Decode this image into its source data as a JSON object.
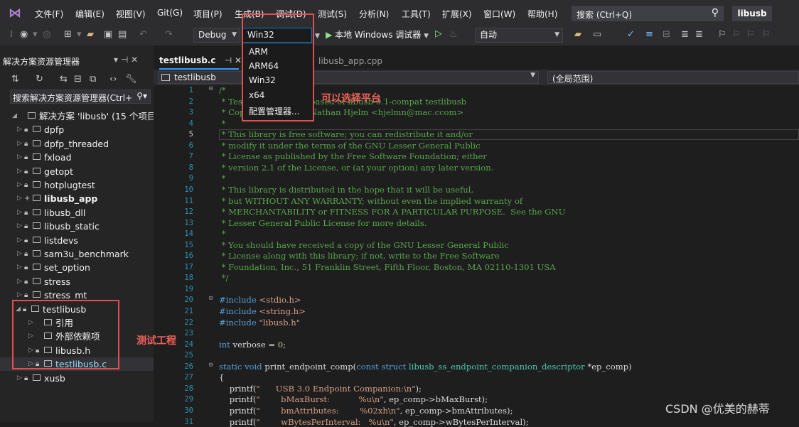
{
  "menu": {
    "items": [
      "文件(F)",
      "编辑(E)",
      "视图(V)",
      "Git(G)",
      "项目(P)",
      "生成(B)",
      "调试(D)",
      "测试(S)",
      "分析(N)",
      "工具(T)",
      "扩展(X)",
      "窗口(W)",
      "帮助(H)"
    ],
    "search_text": "搜索 (Ctrl+Q)",
    "project_badge": "libusb"
  },
  "toolbar": {
    "config": "Debug",
    "platform": "Win32",
    "run_label": "本地 Windows 调试器",
    "run_glyph": "▶",
    "auto": "自动"
  },
  "platform_dropdown": {
    "items": [
      "ARM",
      "ARM64",
      "Win32",
      "x64",
      "配置管理器..."
    ]
  },
  "solution_explorer": {
    "title": "解决方案资源管理器",
    "title_icons": "▾ ⊣ ✕",
    "search_placeholder": "搜索解决方案资源管理器(Ctrl+",
    "solution_label": "解决方案 'libusb' (15 个项目, 共",
    "projects": [
      "dpfp",
      "dpfp_threaded",
      "fxload",
      "getopt",
      "hotplugtest",
      "libusb_app",
      "libusb_dll",
      "libusb_static",
      "listdevs",
      "sam3u_benchmark",
      "set_option",
      "stress",
      "stress_mt",
      "testlibusb"
    ],
    "bold_project": "libusb_app",
    "children": [
      "引用",
      "外部依赖项",
      "libusb.h",
      "testlibusb.c"
    ],
    "last_project": "xusb"
  },
  "editor": {
    "tab_active": "testlibusb.c",
    "tab_active_icons": "⊣ ✕",
    "tab_inactive": "libusb_app.cpp",
    "nav_left": "testlibusb",
    "nav_right": "(全局范围)"
  },
  "code_lines": [
    {
      "n": "1",
      "t": "/*"
    },
    {
      "n": "2",
      "t": " * Test suite program based of libusb-0.1-compat testlibusb"
    },
    {
      "n": "3",
      "t": " * Copyright (c) 2013 Nathan Hjelm <hjelmn@mac.ccom>"
    },
    {
      "n": "4",
      "t": " *"
    },
    {
      "n": "5",
      "t": " * This library is free software; you can redistribute it and/or"
    },
    {
      "n": "6",
      "t": " * modify it under the terms of the GNU Lesser General Public"
    },
    {
      "n": "7",
      "t": " * License as published by the Free Software Foundation; either"
    },
    {
      "n": "8",
      "t": " * version 2.1 of the License, or (at your option) any later version."
    },
    {
      "n": "9",
      "t": " *"
    },
    {
      "n": "10",
      "t": " * This library is distributed in the hope that it will be useful,"
    },
    {
      "n": "11",
      "t": " * but WITHOUT ANY WARRANTY; without even the implied warranty of"
    },
    {
      "n": "12",
      "t": " * MERCHANTABILITY or FITNESS FOR A PARTICULAR PURPOSE.  See the GNU"
    },
    {
      "n": "13",
      "t": " * Lesser General Public License for more details."
    },
    {
      "n": "14",
      "t": " *"
    },
    {
      "n": "15",
      "t": " * You should have received a copy of the GNU Lesser General Public"
    },
    {
      "n": "16",
      "t": " * License along with this library; if not, write to the Free Software"
    },
    {
      "n": "17",
      "t": " * Foundation, Inc., 51 Franklin Street, Fifth Floor, Boston, MA 02110-1301 USA"
    },
    {
      "n": "18",
      "t": " */"
    },
    {
      "n": "19",
      "t": ""
    },
    {
      "n": "20",
      "t": "#include <stdio.h>"
    },
    {
      "n": "21",
      "t": "#include <string.h>"
    },
    {
      "n": "22",
      "t": "#include \"libusb.h\""
    },
    {
      "n": "23",
      "t": ""
    },
    {
      "n": "24",
      "t": "int verbose = 0;"
    },
    {
      "n": "25",
      "t": ""
    },
    {
      "n": "26",
      "t": "static void print_endpoint_comp(const struct libusb_ss_endpoint_companion_descriptor *ep_comp)"
    },
    {
      "n": "27",
      "t": "{"
    },
    {
      "n": "28",
      "t": "    printf(\"      USB 3.0 Endpoint Companion:\\n\");"
    },
    {
      "n": "29",
      "t": "    printf(\"        bMaxBurst:           %u\\n\", ep_comp->bMaxBurst);"
    },
    {
      "n": "30",
      "t": "    printf(\"        bmAttributes:        %02xh\\n\", ep_comp->bmAttributes);"
    },
    {
      "n": "31",
      "t": "    printf(\"        wBytesPerInterval:   %u\\n\", ep_comp->wBytesPerInterval);"
    }
  ],
  "annotations": {
    "platform_note": "可以选择平台",
    "project_note": "测试工程",
    "watermark": "CSDN @优美的赫蒂"
  },
  "colors": {
    "accent": "#3399ff",
    "annotation_red": "#e05050",
    "comment_green": "#57a64a"
  }
}
